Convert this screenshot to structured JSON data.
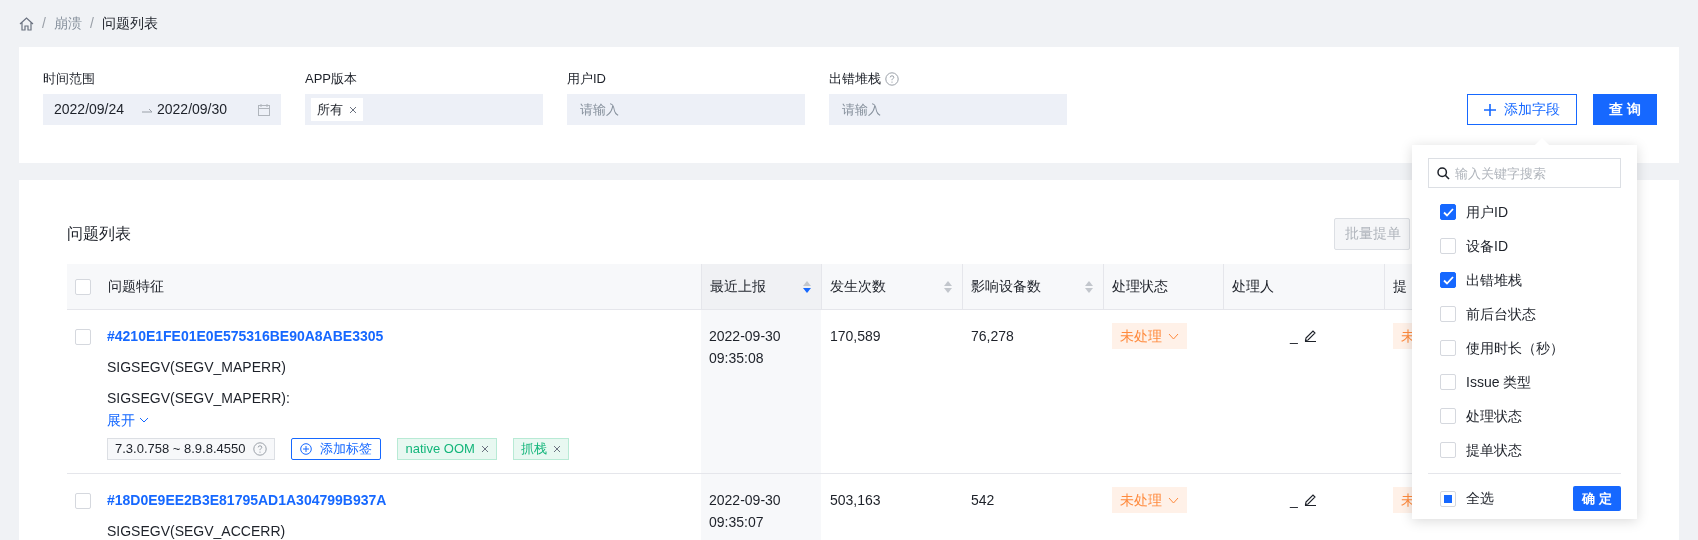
{
  "breadcrumb_separator": "/",
  "breadcrumb": [
    {
      "label": "崩溃"
    },
    {
      "label": "问题列表"
    }
  ],
  "filters": [
    {
      "label": "时间范围",
      "kind": "date_range",
      "start": "2022/09/24",
      "end": "2022/09/30"
    },
    {
      "label": "APP版本",
      "kind": "tags",
      "tags": [
        "所有"
      ]
    },
    {
      "label": "用户ID",
      "kind": "text",
      "placeholder": "请输入"
    },
    {
      "label": "出错堆栈",
      "kind": "text",
      "placeholder": "请输入",
      "help": true
    }
  ],
  "add_field_button": "添加字段",
  "query_button": "查 询",
  "table": {
    "title": "问题列表",
    "batch_button": "批量提单",
    "header_checked": false,
    "columns": [
      {
        "label": "问题特征"
      },
      {
        "label": "最近上报",
        "sortable": true,
        "sort_desc": true
      },
      {
        "label": "发生次数",
        "sortable": true,
        "sort_desc": false
      },
      {
        "label": "影响设备数",
        "sortable": true,
        "sort_desc": false
      },
      {
        "label": "处理状态"
      },
      {
        "label": "处理人"
      },
      {
        "label": "提"
      }
    ],
    "rows": [
      {
        "checked": false,
        "id": "#4210E1FE01E0E575316BE90A8ABE3305",
        "signal": "SIGSEGV(SEGV_MAPERR)",
        "detail": "SIGSEGV(SEGV_MAPERR):",
        "expand": "展开",
        "version": "7.3.0.758 ~ 8.9.8.4550",
        "add_tag": "添加标签",
        "tags": [
          "native OOM",
          "抓栈"
        ],
        "date": "2022-09-30",
        "time": "09:35:08",
        "count": "170,589",
        "devices": "76,278",
        "status": "未处理",
        "handler": "_",
        "ticket": "未"
      },
      {
        "checked": false,
        "id": "#18D0E9EE2B3E81795AD1A304799B937A",
        "signal": "SIGSEGV(SEGV_ACCERR)",
        "date": "2022-09-30",
        "time": "09:35:07",
        "count": "503,163",
        "devices": "542",
        "status": "未处理",
        "handler": "_",
        "ticket": "未"
      }
    ]
  },
  "field_menu": {
    "search_placeholder": "输入关键字搜索",
    "options": [
      {
        "label": "用户ID",
        "checked": true
      },
      {
        "label": "设备ID",
        "checked": false
      },
      {
        "label": "出错堆栈",
        "checked": true
      },
      {
        "label": "前后台状态",
        "checked": false
      },
      {
        "label": "使用时长（秒）",
        "checked": false
      },
      {
        "label": "Issue 类型",
        "checked": false
      },
      {
        "label": "处理状态",
        "checked": false
      },
      {
        "label": "提单状态",
        "checked": false
      }
    ],
    "select_all": {
      "label": "全选",
      "indeterminate": true
    },
    "confirm": "确 定"
  }
}
